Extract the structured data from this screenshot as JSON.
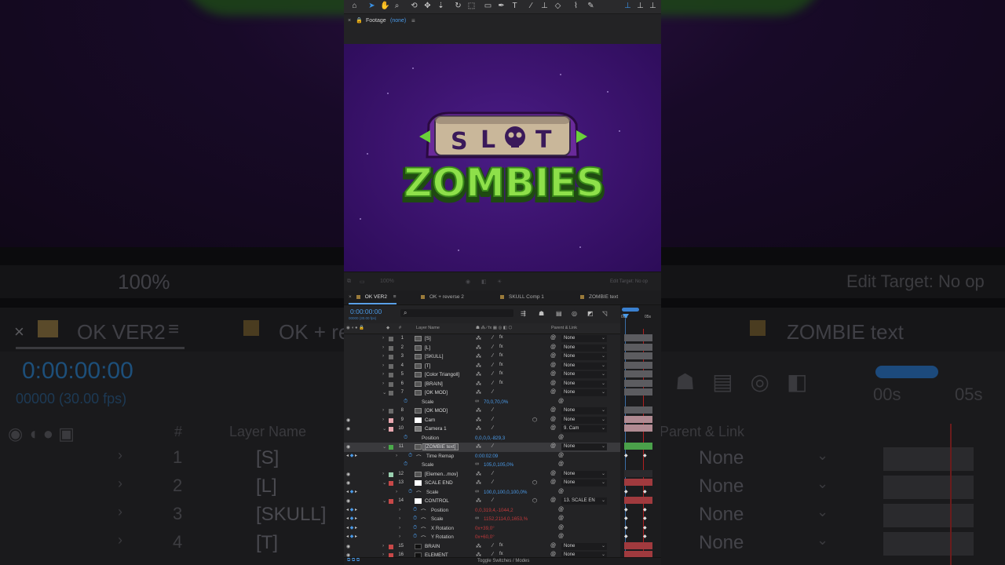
{
  "colors": {
    "accent": "#4a9ae8",
    "red_value": "#c0393b",
    "purple_bg": "#3d1470"
  },
  "footage": {
    "label": "Footage",
    "value": "(none)"
  },
  "viewer": {
    "zoom": "100%",
    "edit_target": "Edit Target: No op"
  },
  "tabs": [
    {
      "label": "OK VER2"
    },
    {
      "label": "OK + reverse 2"
    },
    {
      "label": "SKULL Comp 1"
    },
    {
      "label": "ZOMBIE text"
    }
  ],
  "timeline": {
    "timecode": "0:00:00:00",
    "fps": "00000 (30.00 fps)",
    "ruler_start": "00s",
    "ruler_end": "05s"
  },
  "columns": {
    "layer_name": "Layer Name",
    "hash": "#",
    "parent_link": "Parent & Link"
  },
  "rows": [
    {
      "type": "layer",
      "num": "1",
      "name": "[S]",
      "icon": "comp-icon",
      "label_color": "#6a6a6a",
      "parent": "None",
      "fx": true,
      "eye": false,
      "open": false
    },
    {
      "type": "layer",
      "num": "2",
      "name": "[L]",
      "icon": "comp-icon",
      "label_color": "#6a6a6a",
      "parent": "None",
      "fx": true,
      "eye": false,
      "open": false
    },
    {
      "type": "layer",
      "num": "3",
      "name": "[SKULL]",
      "icon": "comp-icon",
      "label_color": "#6a6a6a",
      "parent": "None",
      "fx": true,
      "eye": false,
      "open": false
    },
    {
      "type": "layer",
      "num": "4",
      "name": "[T]",
      "icon": "comp-icon",
      "label_color": "#6a6a6a",
      "parent": "None",
      "fx": true,
      "eye": false,
      "open": false
    },
    {
      "type": "layer",
      "num": "5",
      "name": "[Color Triangoll]",
      "icon": "comp-icon",
      "label_color": "#6a6a6a",
      "parent": "None",
      "fx": true,
      "eye": false,
      "open": false
    },
    {
      "type": "layer",
      "num": "6",
      "name": "[BRAIN]",
      "icon": "comp-icon",
      "label_color": "#6a6a6a",
      "parent": "None",
      "fx": true,
      "eye": false,
      "open": false
    },
    {
      "type": "layer",
      "num": "7",
      "name": "[OK MOD]",
      "icon": "comp-icon",
      "label_color": "#6a6a6a",
      "parent": "None",
      "fx": false,
      "eye": false,
      "open": true
    },
    {
      "type": "prop",
      "name": "Scale",
      "value": "70,0,70,0%",
      "color": "blue",
      "indent": "1"
    },
    {
      "type": "layer",
      "num": "8",
      "name": "[OK MOD]",
      "icon": "comp-icon",
      "label_color": "#6a6a6a",
      "parent": "None",
      "fx": false,
      "eye": false,
      "open": false
    },
    {
      "type": "layer",
      "num": "9",
      "name": "Cam",
      "icon": "solid-icon",
      "label_color": "#e8a8b0",
      "parent": "None",
      "fx": false,
      "eye": true,
      "open": false,
      "threed": true
    },
    {
      "type": "layer",
      "num": "10",
      "name": "Camera 1",
      "icon": "camera-icon",
      "label_color": "#e8a8b0",
      "parent": "9. Cam",
      "fx": false,
      "eye": true,
      "open": true
    },
    {
      "type": "prop",
      "name": "Position",
      "value": "0,0,0,0,-829,3",
      "color": "blue",
      "indent": "1"
    },
    {
      "type": "layer",
      "num": "11",
      "name": "[ZOMBIE text]",
      "icon": "comp-icon",
      "label_color": "#4aaa4a",
      "parent": "None",
      "fx": false,
      "eye": true,
      "open": true,
      "selected": true
    },
    {
      "type": "prop",
      "name": "Time Remap",
      "value": "0:00:02:09",
      "color": "blue",
      "indent": "2",
      "keyframed": true
    },
    {
      "type": "prop",
      "name": "Scale",
      "value": "105,0,105,0%",
      "color": "blue",
      "indent": "1"
    },
    {
      "type": "layer",
      "num": "12",
      "name": "[Elemen...mov]",
      "icon": "footage-icon",
      "label_color": "#9ad0b0",
      "parent": "None",
      "fx": false,
      "eye": true,
      "open": false
    },
    {
      "type": "layer",
      "num": "13",
      "name": "SCALE END",
      "icon": "solid-icon",
      "label_color": "#c84848",
      "parent": "None",
      "fx": false,
      "eye": true,
      "open": true,
      "threed": true
    },
    {
      "type": "prop",
      "name": "Scale",
      "value": "100,0,100,0,100,0%",
      "color": "blue",
      "indent": "2",
      "keyframed": true
    },
    {
      "type": "layer",
      "num": "14",
      "name": "CONTROL",
      "icon": "solid-icon",
      "label_color": "#c84848",
      "parent": "13. SCALE EN",
      "fx": false,
      "eye": true,
      "open": true,
      "threed": true
    },
    {
      "type": "prop",
      "name": "Position",
      "value": "0,0,319,4,-1044,2",
      "color": "red",
      "indent": "3",
      "keyframed": true
    },
    {
      "type": "prop",
      "name": "Scale",
      "value": "1152,2114,0,1653,%",
      "color": "red",
      "indent": "3",
      "keyframed": true
    },
    {
      "type": "prop",
      "name": "X Rotation",
      "value": "0x+39,0°",
      "color": "red",
      "indent": "3",
      "keyframed": true
    },
    {
      "type": "prop",
      "name": "Y Rotation",
      "value": "0x+60,0°",
      "color": "red",
      "indent": "3",
      "keyframed": true
    },
    {
      "type": "layer",
      "num": "15",
      "name": "BRAIN",
      "icon": "solid-dark-icon",
      "label_color": "#c84848",
      "parent": "None",
      "fx": true,
      "eye": true,
      "open": false
    },
    {
      "type": "layer",
      "num": "16",
      "name": "ELEMENT",
      "icon": "solid-dark-icon",
      "label_color": "#c84848",
      "parent": "None",
      "fx": true,
      "eye": true,
      "open": false
    }
  ],
  "status": {
    "toggle": "Toggle Switches / Modes"
  },
  "logo": {
    "slot_letters": [
      "S",
      "L",
      "T"
    ],
    "word": "ZOMBIES"
  }
}
